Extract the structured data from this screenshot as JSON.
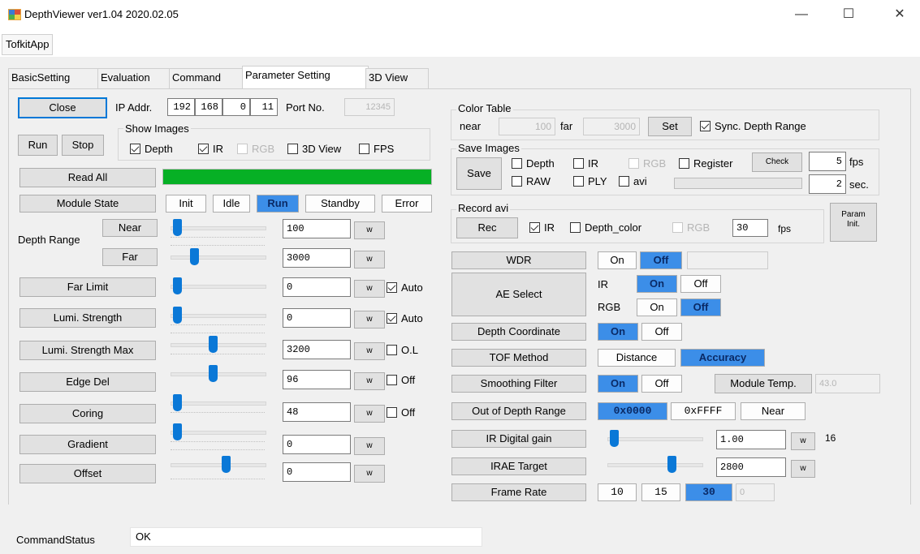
{
  "window": {
    "title": "DepthViewer ver1.04 2020.02.05",
    "minimize_glyph": "—",
    "maximize_glyph": "☐",
    "close_glyph": "✕"
  },
  "menu": {
    "item": "TofkitApp"
  },
  "tabs": [
    "BasicSetting",
    "Evaluation",
    "Command",
    "Parameter Setting",
    "3D View"
  ],
  "active_tab_index": 3,
  "left": {
    "close_label": "Close",
    "ip_label": "IP Addr.",
    "ip": [
      "192",
      "168",
      "0",
      "11"
    ],
    "port_label": "Port No.",
    "port_value": "12345",
    "run_label": "Run",
    "stop_label": "Stop",
    "show_images": {
      "title": "Show Images",
      "depth": "Depth",
      "ir": "IR",
      "rgb": "RGB",
      "view3d": "3D View",
      "fps": "FPS"
    },
    "read_all_label": "Read All",
    "progress_fraction": 1.0,
    "module_state_label": "Module State",
    "states": [
      "Init",
      "Idle",
      "Run",
      "Standby",
      "Error"
    ],
    "depth_range_label": "Depth Range",
    "near_label": "Near",
    "far_label": "Far",
    "near_value": "100",
    "far_value": "3000",
    "unit_w": "w",
    "far_limit_label": "Far Limit",
    "far_limit_value": "0",
    "auto_label": "Auto",
    "lumi_label": "Lumi. Strength",
    "lumi_value": "0",
    "lumi_max_label": "Lumi. Strength Max",
    "lumi_max_value": "3200",
    "ol_label": "O.L",
    "edge_label": "Edge Del",
    "edge_value": "96",
    "off_label": "Off",
    "coring_label": "Coring",
    "coring_value": "48",
    "gradient_label": "Gradient",
    "gradient_value": "0",
    "offset_label": "Offset",
    "offset_value": "0"
  },
  "sliders": {
    "near": 0.03,
    "far": 0.23,
    "far_limit": 0.03,
    "lumi": 0.03,
    "lumi_max": 0.45,
    "edge": 0.45,
    "coring": 0.03,
    "gradient": 0.03,
    "offset": 0.6,
    "ir_gain": 0.03,
    "irae": 0.7
  },
  "right": {
    "color_table_title": "Color Table",
    "near_label": "near",
    "near_value": "100",
    "far_label": "far",
    "far_value": "3000",
    "set_label": "Set",
    "sync_label": "Sync. Depth Range",
    "save_images_title": "Save Images",
    "save_label": "Save",
    "depth": "Depth",
    "ir": "IR",
    "rgb": "RGB",
    "register": "Register",
    "check_label": "Check",
    "fps_value": "5",
    "fps_label": "fps",
    "raw": "RAW",
    "ply": "PLY",
    "avi": "avi",
    "sec_value": "2",
    "sec_label": "sec.",
    "record_avi_title": "Record avi",
    "rec_label": "Rec",
    "rec_ir": "IR",
    "rec_depth_color": "Depth_color",
    "rec_rgb": "RGB",
    "rec_fps_value": "30",
    "rec_fps_label": "fps",
    "param_init_line1": "Param",
    "param_init_line2": "Init.",
    "wdr_label": "WDR",
    "on": "On",
    "off": "Off",
    "ae_select_label": "AE Select",
    "ir_label": "IR",
    "rgb_label": "RGB",
    "depth_coord_label": "Depth Coordinate",
    "tof_method_label": "TOF Method",
    "distance_label": "Distance",
    "accuracy_label": "Accuracy",
    "smoothing_label": "Smoothing Filter",
    "module_temp_label": "Module Temp.",
    "module_temp_value": "43.0",
    "out_of_depth_label": "Out of Depth Range",
    "ood_options": [
      "0x0000",
      "0xFFFF",
      "Near"
    ],
    "ir_gain_label": "IR Digital gain",
    "ir_gain_value": "1.00",
    "ir_gain_max": "16",
    "irae_label": "IRAE Target",
    "irae_value": "2800",
    "frame_rate_label": "Frame Rate",
    "frame_rates": [
      "10",
      "15",
      "30"
    ],
    "frame_rate_extra": "0"
  },
  "status": {
    "label": "CommandStatus",
    "value": "OK"
  },
  "colors": {
    "accent": "#3c8ee8",
    "progress": "#06b025",
    "slider_thumb": "#0a78d7"
  }
}
